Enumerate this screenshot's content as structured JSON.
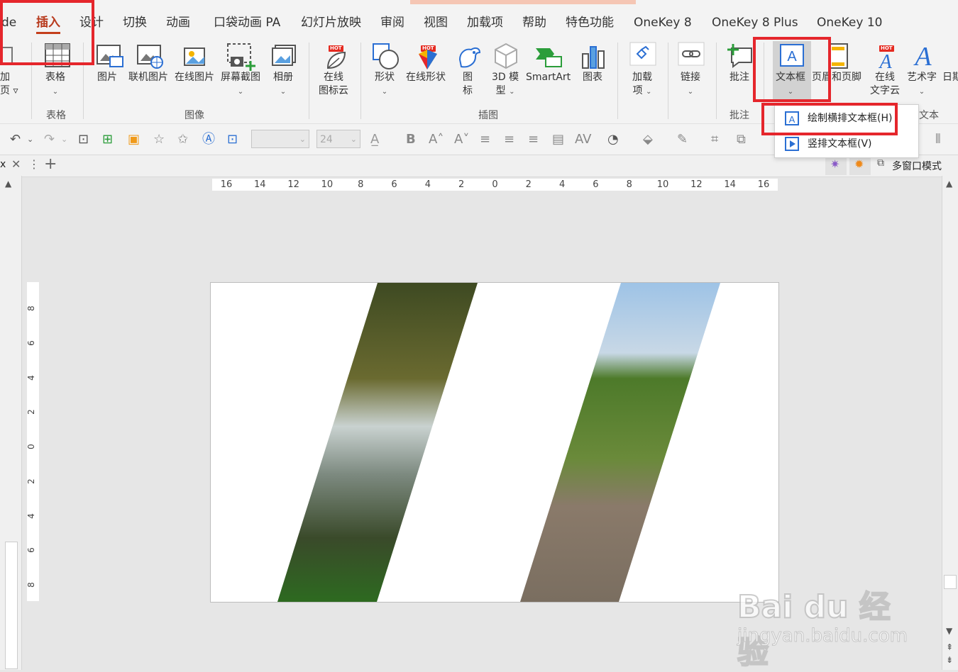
{
  "tabs": [
    "de",
    "插入",
    "设计",
    "切换",
    "动画",
    "口袋动画 PA",
    "幻灯片放映",
    "审阅",
    "视图",
    "加载项",
    "帮助",
    "特色功能",
    "OneKey 8",
    "OneKey 8 Plus",
    "OneKey 10"
  ],
  "active_tab": "插入",
  "ribbon": {
    "partial_left": {
      "line1": "加",
      "line2": "页 ▿"
    },
    "table": "表格",
    "picture": "图片",
    "online_picture": "联机图片",
    "web_picture": "在线图片",
    "screenshot": "屏幕截图",
    "album": "相册",
    "online_icons": {
      "line1": "在线",
      "line2": "图标云"
    },
    "shapes": "形状",
    "online_shapes": "在线形状",
    "icons": {
      "line1": "图",
      "line2": "标"
    },
    "model3d": {
      "line1": "3D 模",
      "line2": "型"
    },
    "smartart": "SmartArt",
    "chart": "图表",
    "addins": {
      "line1": "加载",
      "line2": "项"
    },
    "link": "链接",
    "comment": "批注",
    "textbox": "文本框",
    "header_footer": "页眉和页脚",
    "online_wordart": {
      "line1": "在线",
      "line2": "文字云"
    },
    "wordart": "艺术字",
    "date": "日期",
    "hot": "HOT",
    "groups": {
      "table": "表格",
      "images": "图像",
      "illustrations": "插图",
      "comments": "批注",
      "text": "文本"
    }
  },
  "qat": {
    "font_size": "24"
  },
  "docbar": {
    "tab_label": "x",
    "multi_window": "多窗口模式"
  },
  "ruler": {
    "h_ticks": [
      "16",
      "14",
      "12",
      "10",
      "8",
      "6",
      "4",
      "2",
      "0",
      "2",
      "4",
      "6",
      "8",
      "10",
      "12",
      "14",
      "16"
    ],
    "v_ticks": [
      "8",
      "6",
      "4",
      "2",
      "0",
      "2",
      "4",
      "6",
      "8"
    ]
  },
  "dropdown": {
    "horizontal": "绘制横排文本框(H)",
    "vertical": "竖排文本框(V)"
  },
  "watermark": {
    "brand": "Bai du 经验",
    "url": "jingyan.baidu.com"
  },
  "colors": {
    "accent": "#c43e1c",
    "highlight": "#e5262c",
    "ribbon_bg": "#f3f3f3",
    "icon_blue": "#2b6fd3"
  }
}
